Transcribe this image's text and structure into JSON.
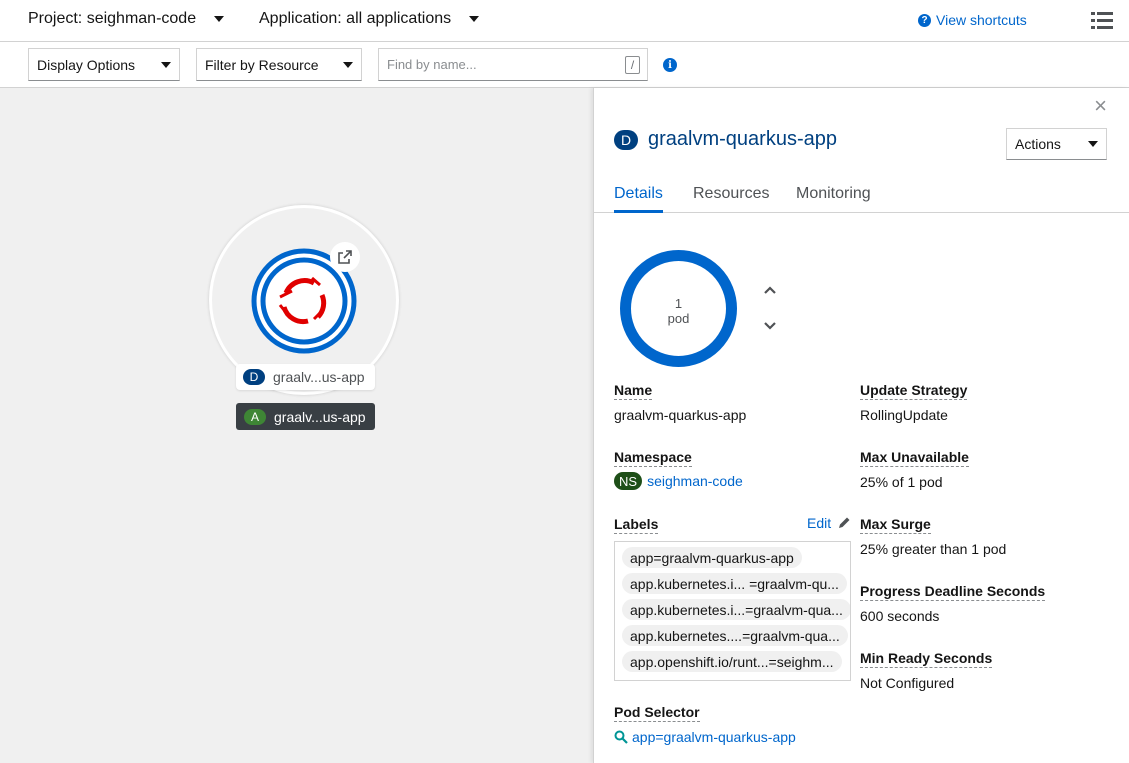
{
  "topbar": {
    "project_label": "Project: seighman-code",
    "application_label": "Application: all applications",
    "shortcuts_label": "View shortcuts"
  },
  "filterbar": {
    "display_options": "Display Options",
    "filter_by_resource": "Filter by Resource",
    "search_placeholder": "Find by name...",
    "search_shortcut_key": "/"
  },
  "topology": {
    "node": {
      "kind_badge": "D",
      "name": "graalv...us-app"
    },
    "application_group": {
      "kind_badge": "A",
      "name": "graalv...us-app"
    }
  },
  "panel": {
    "kind_badge": "D",
    "title": "graalvm-quarkus-app",
    "actions_label": "Actions",
    "tabs": [
      "Details",
      "Resources",
      "Monitoring"
    ],
    "pod_ring": {
      "count": "1",
      "unit": "pod",
      "ring_color": "#0066cc"
    },
    "details": {
      "name_label": "Name",
      "name_value": "graalvm-quarkus-app",
      "namespace_label": "Namespace",
      "namespace_badge": "NS",
      "namespace_value": "seighman-code",
      "labels_label": "Labels",
      "edit_label": "Edit",
      "labels": [
        "app=graalvm-quarkus-app",
        "app.kubernetes.i... =graalvm-qu...",
        "app.kubernetes.i...=graalvm-qua...",
        "app.kubernetes....=graalvm-qua...",
        "app.openshift.io/runt...=seighm..."
      ],
      "pod_selector_label": "Pod Selector",
      "pod_selector_value": "app=graalvm-quarkus-app",
      "update_strategy_label": "Update Strategy",
      "update_strategy_value": "RollingUpdate",
      "max_unavailable_label": "Max Unavailable",
      "max_unavailable_value": "25% of 1 pod",
      "max_surge_label": "Max Surge",
      "max_surge_value": "25% greater than 1 pod",
      "progress_deadline_label": "Progress Deadline Seconds",
      "progress_deadline_value": "600 seconds",
      "min_ready_label": "Min Ready Seconds",
      "min_ready_value": "Not Configured"
    }
  },
  "colors": {
    "link": "#0066cc",
    "deployment_badge": "#004080",
    "application_badge": "#3e8635",
    "namespace_badge": "#1e4f18",
    "openshift_logo": "#e00000"
  }
}
